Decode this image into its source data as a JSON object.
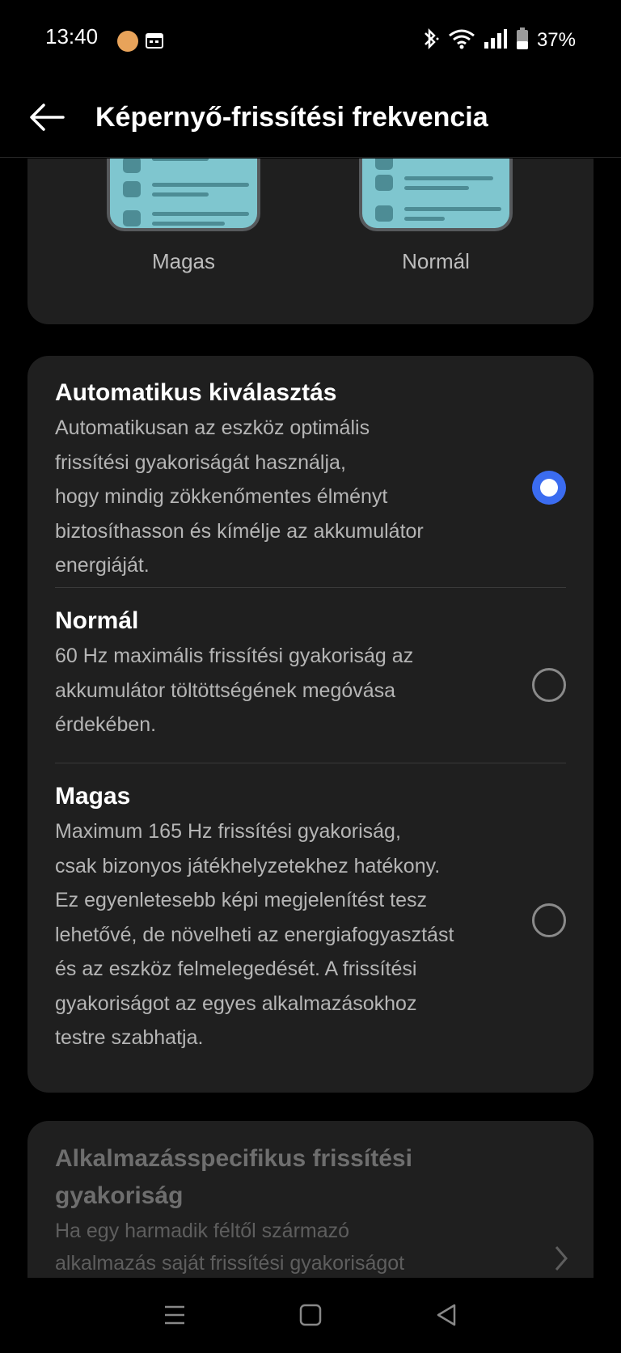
{
  "status_bar": {
    "time": "13:40",
    "battery_percent": "37%",
    "icons": [
      "app-notification-icon",
      "calendar-icon",
      "bluetooth-icon",
      "wifi-icon",
      "signal-icon",
      "battery-icon"
    ]
  },
  "header": {
    "title": "Képernyő-frissítési frekvencia",
    "back_icon": "arrow-left-icon"
  },
  "preview": {
    "left_label": "Magas",
    "right_label": "Normál"
  },
  "options": [
    {
      "title": "Automatikus kiválasztás",
      "desc_lines": [
        "Automatikusan az eszköz optimális",
        "frissítési gyakoriságát használja,",
        "hogy mindig zökkenőmentes élményt",
        "biztosíthasson és kímélje az akkumulátor",
        "energiáját."
      ],
      "selected": true
    },
    {
      "title": "Normál",
      "desc_lines": [
        "60 Hz maximális frissítési gyakoriság az",
        "akkumulátor töltöttségének megóvása",
        "érdekében."
      ],
      "selected": false
    },
    {
      "title": "Magas",
      "desc_lines": [
        "Maximum 165 Hz frissítési gyakoriság,",
        "csak bizonyos játékhelyzetekhez hatékony.",
        "Ez egyenletesebb képi megjelenítést tesz",
        "lehetővé, de növelheti az energiafogyasztást",
        "és az eszköz felmelegedését. A frissítési",
        "gyakoriságot az egyes alkalmazásokhoz",
        "testre szabhatja."
      ],
      "selected": false
    }
  ],
  "app_specific": {
    "title_lines": [
      "Alkalmazásspecifikus frissítési",
      "gyakoriság"
    ],
    "desc_lines": [
      "Ha egy harmadik féltől származó",
      "alkalmazás saját frissítési gyakoriságot"
    ],
    "chevron_icon": "chevron-right-icon"
  },
  "colors": {
    "accent": "#3b6cf0",
    "card_bg": "#1f1f1f",
    "background": "#000000",
    "preview_phone": "#7fc6cf"
  },
  "nav_bar": {
    "icons": [
      "menu-icon",
      "home-icon",
      "back-triangle-icon"
    ]
  }
}
